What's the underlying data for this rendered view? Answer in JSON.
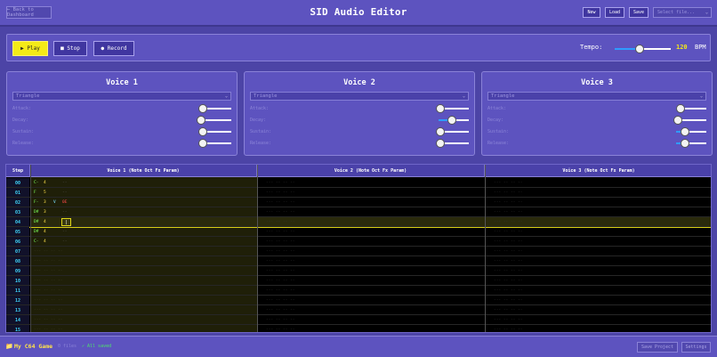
{
  "header": {
    "back_label": "← Back to Dashboard",
    "title": "SID Audio Editor",
    "new_label": "New",
    "load_label": "Load",
    "save_label": "Save",
    "file_select_placeholder": "Select file..."
  },
  "transport": {
    "play_label": "▶ Play",
    "stop_label": "■ Stop",
    "record_label": "● Record",
    "tempo_label": "Tempo:",
    "tempo_value": "120",
    "tempo_unit": "BPM",
    "tempo_fraction": 0.45
  },
  "voices": [
    {
      "title": "Voice 1",
      "waveform": "Triangle",
      "params": {
        "attack": 0.05,
        "decay": 0.0,
        "sustain": 0.05,
        "release": 0.05
      }
    },
    {
      "title": "Voice 2",
      "waveform": "Triangle",
      "params": {
        "attack": 0.05,
        "decay": 0.45,
        "sustain": 0.05,
        "release": 0.05
      }
    },
    {
      "title": "Voice 3",
      "waveform": "Triangle",
      "params": {
        "attack": 0.15,
        "decay": 0.05,
        "sustain": 0.3,
        "release": 0.3
      }
    }
  ],
  "param_labels": {
    "attack": "Attack:",
    "decay": "Decay:",
    "sustain": "Sustain:",
    "release": "Release:"
  },
  "tracker": {
    "step_header": "Step",
    "voice_headers": [
      "Voice 1 (Note Oct Fx Param)",
      "Voice 2 (Note Oct Fx Param)",
      "Voice 3 (Note Oct Fx Param)"
    ],
    "empty_cell": "--- -- -- --",
    "cursor_glyph": "|",
    "rows": [
      {
        "step": "00",
        "note": "C-",
        "oct": "4",
        "fx": "",
        "param": "--"
      },
      {
        "step": "01",
        "note": "F",
        "oct": "5",
        "fx": "",
        "param": "--"
      },
      {
        "step": "02",
        "note": "F-",
        "oct": "3",
        "fx": "V",
        "param": "0E"
      },
      {
        "step": "03",
        "note": "D#",
        "oct": "3",
        "fx": "",
        "param": "--"
      },
      {
        "step": "04",
        "note": "D#",
        "oct": "4",
        "fx": "",
        "param": ""
      },
      {
        "step": "05",
        "note": "D#",
        "oct": "4",
        "fx": "",
        "param": "--"
      },
      {
        "step": "06",
        "note": "C-",
        "oct": "4",
        "fx": "",
        "param": "--"
      },
      {
        "step": "07",
        "note": "",
        "oct": "",
        "fx": "",
        "param": ""
      },
      {
        "step": "08",
        "note": "",
        "oct": "",
        "fx": "",
        "param": ""
      },
      {
        "step": "09",
        "note": "",
        "oct": "",
        "fx": "",
        "param": ""
      },
      {
        "step": "10",
        "note": "",
        "oct": "",
        "fx": "",
        "param": ""
      },
      {
        "step": "11",
        "note": "",
        "oct": "",
        "fx": "",
        "param": ""
      },
      {
        "step": "12",
        "note": "",
        "oct": "",
        "fx": "",
        "param": ""
      },
      {
        "step": "13",
        "note": "",
        "oct": "",
        "fx": "",
        "param": ""
      },
      {
        "step": "14",
        "note": "",
        "oct": "",
        "fx": "",
        "param": ""
      },
      {
        "step": "15",
        "note": "",
        "oct": "",
        "fx": "",
        "param": ""
      }
    ]
  },
  "status": {
    "folder_icon": "📁",
    "project_name": "My C64 Game",
    "files_label": "0 files",
    "saved_label": "✓ All saved",
    "save_project_label": "Save Project",
    "settings_label": "Settings"
  },
  "colors": {
    "accent_yellow": "#f4ea17",
    "step_cyan": "#3fd9ff",
    "slider_blue": "#2f9bff",
    "saved_green": "#4de36a"
  }
}
